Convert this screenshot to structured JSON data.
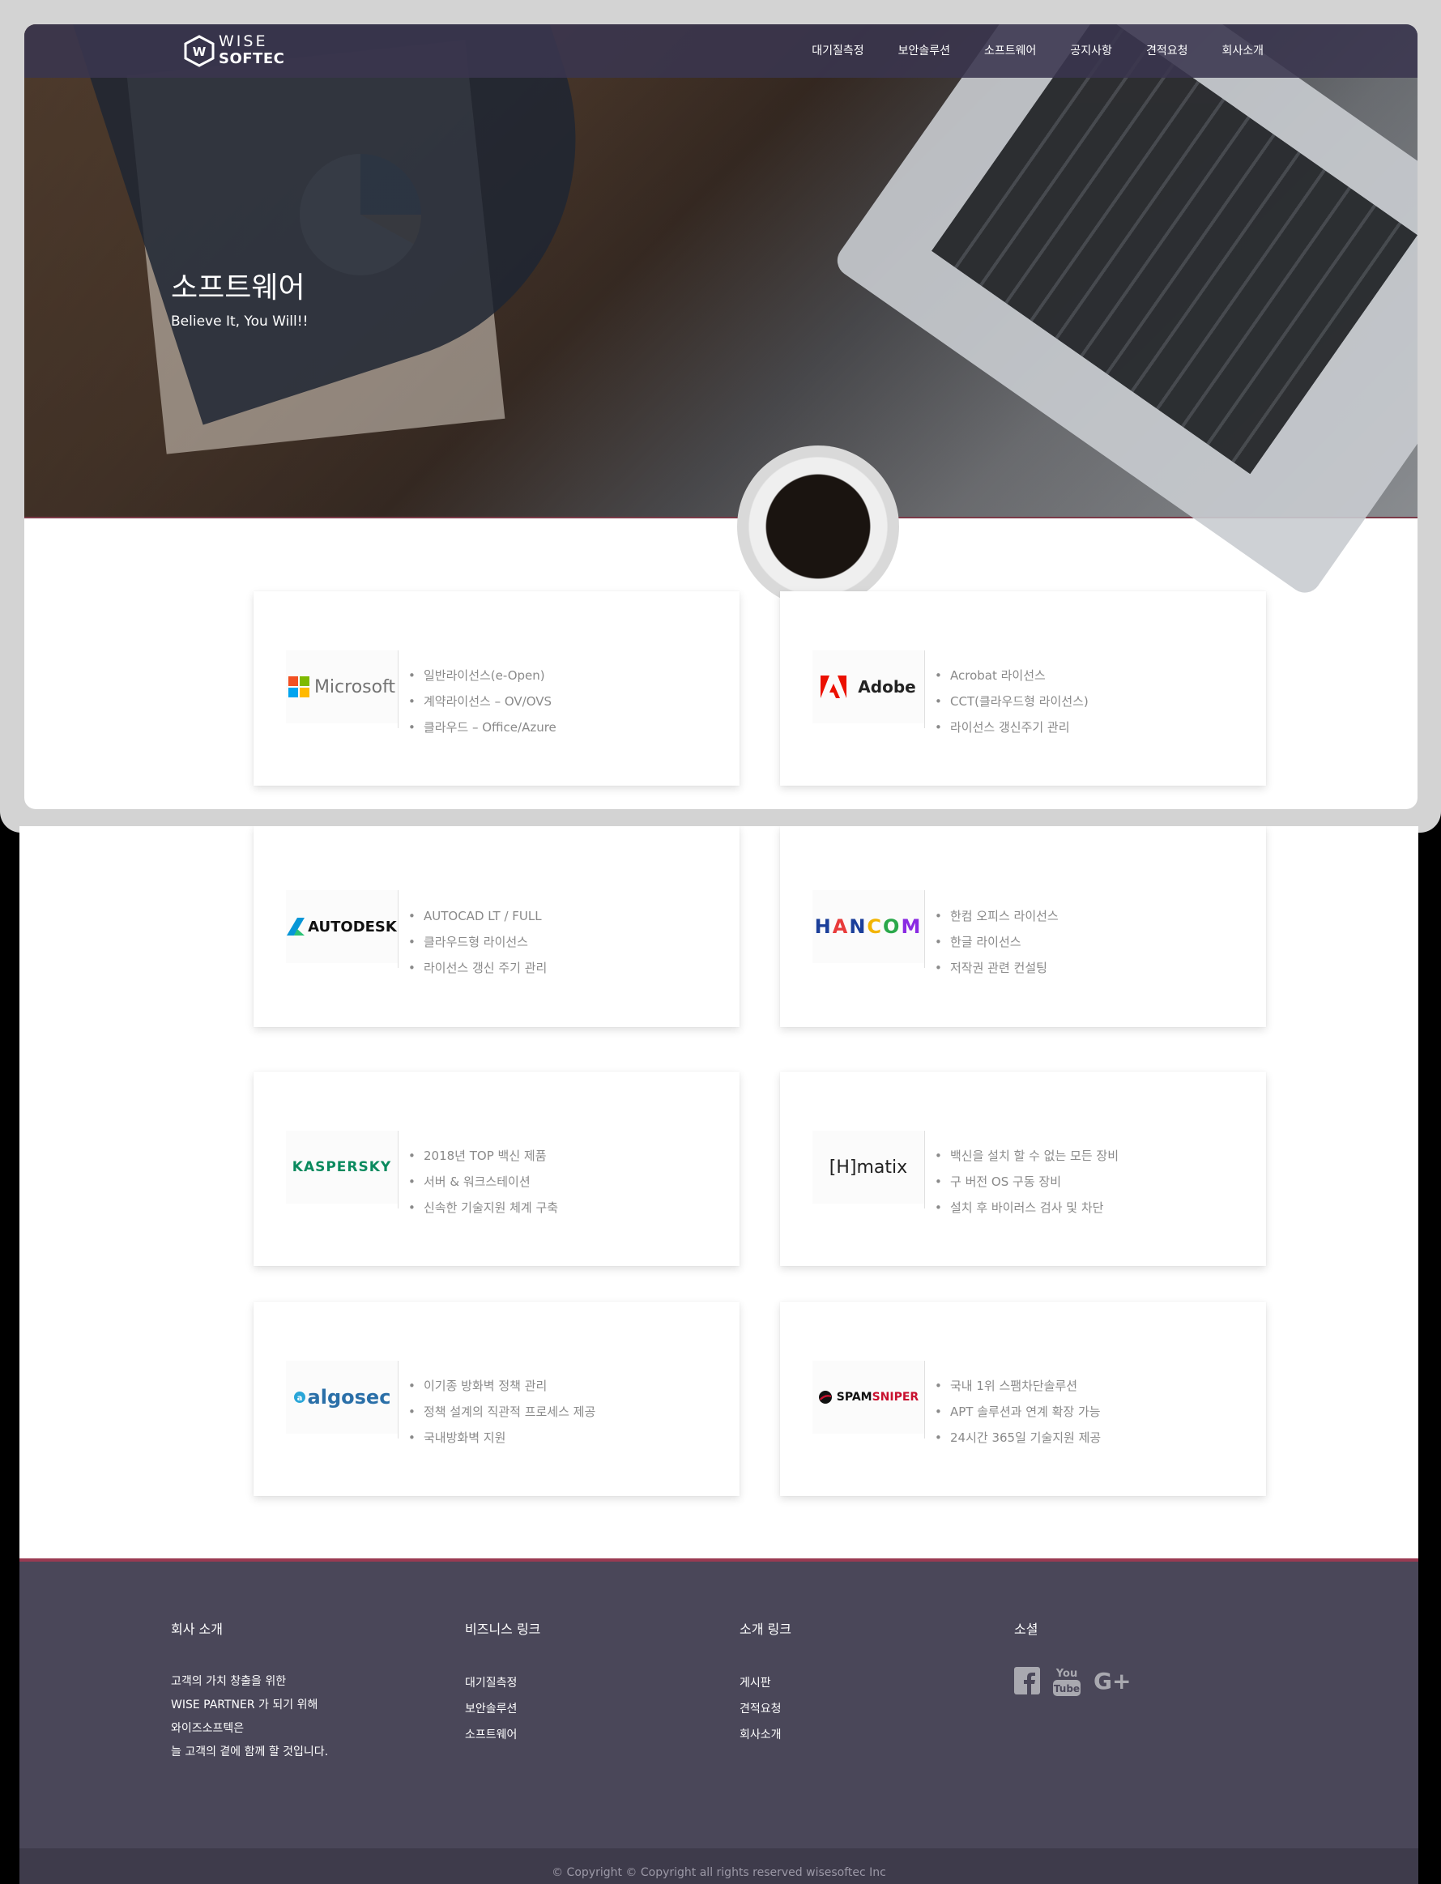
{
  "header": {
    "logo_line1": "WISE",
    "logo_line2": "SOFTEC",
    "menu": [
      "대기질측정",
      "보안솔루션",
      "소프트웨어",
      "공지사항",
      "견적요청",
      "회사소개"
    ]
  },
  "hero": {
    "title": "소프트웨어",
    "subtitle": "Believe It, You Will!!"
  },
  "products": [
    {
      "logo": "Microsoft",
      "items": [
        "일반라이선스(e-Open)",
        "계약라이선스 – OV/OVS",
        "클라우드 – Office/Azure"
      ]
    },
    {
      "logo": "Adobe",
      "items": [
        "Acrobat 라이선스",
        "CCT(클라우드형 라이선스)",
        "라이선스 갱신주기 관리"
      ]
    },
    {
      "logo": "AUTODESK",
      "items": [
        "AUTOCAD LT / FULL",
        "클라우드형 라이선스",
        "라이선스 갱신 주기 관리"
      ]
    },
    {
      "logo": "HANCOM",
      "items": [
        "한컴 오피스 라이선스",
        "한글 라이선스",
        "저작권 관련 컨설팅"
      ]
    },
    {
      "logo": "KASPERSKY",
      "items": [
        "2018년 TOP 백신 제품",
        "서버 & 워크스테이션",
        "신속한 기술지원 체계 구축"
      ]
    },
    {
      "logo": "[H]matix",
      "items": [
        "백신을 설치 할 수 없는 모든 장비",
        "구 버전 OS 구동 장비",
        "설치 후 바이러스 검사 및 차단"
      ]
    },
    {
      "logo": "algosec",
      "items": [
        "이기종 방화벽 정책 관리",
        "정책 설계의 직관적 프로세스 제공",
        "국내방화벽 지원"
      ]
    },
    {
      "logo": "SPAMSNIPER",
      "items": [
        "국내 1위 스팸차단솔루션",
        "APT 솔루션과 연계 확장 가능",
        "24시간 365일 기술지원 제공"
      ]
    }
  ],
  "footer": {
    "about_title": "회사 소개",
    "about_lines": [
      "고객의 가치 창출을 위한",
      "WISE PARTNER 가 되기 위해",
      "와이즈소프텍은",
      "늘 고객의 곁에 함께 할 것입니다."
    ],
    "biz_title": "비즈니스 링크",
    "biz_links": [
      "대기질측정",
      "보안솔루션",
      "소프트웨어"
    ],
    "intro_title": "소개 링크",
    "intro_links": [
      "게시판",
      "견적요청",
      "회사소개"
    ],
    "social_title": "소셜",
    "social_icons": [
      "facebook-icon",
      "youtube-icon",
      "google-plus-icon"
    ],
    "copyright": "© Copyright © Copyright all rights reserved wisesoftec Inc"
  },
  "colors": {
    "nav_bg": "#3a364e",
    "footer_bg": "#4a4759",
    "footer_accent": "#9a3a52",
    "list_text": "#8a8a8a"
  }
}
